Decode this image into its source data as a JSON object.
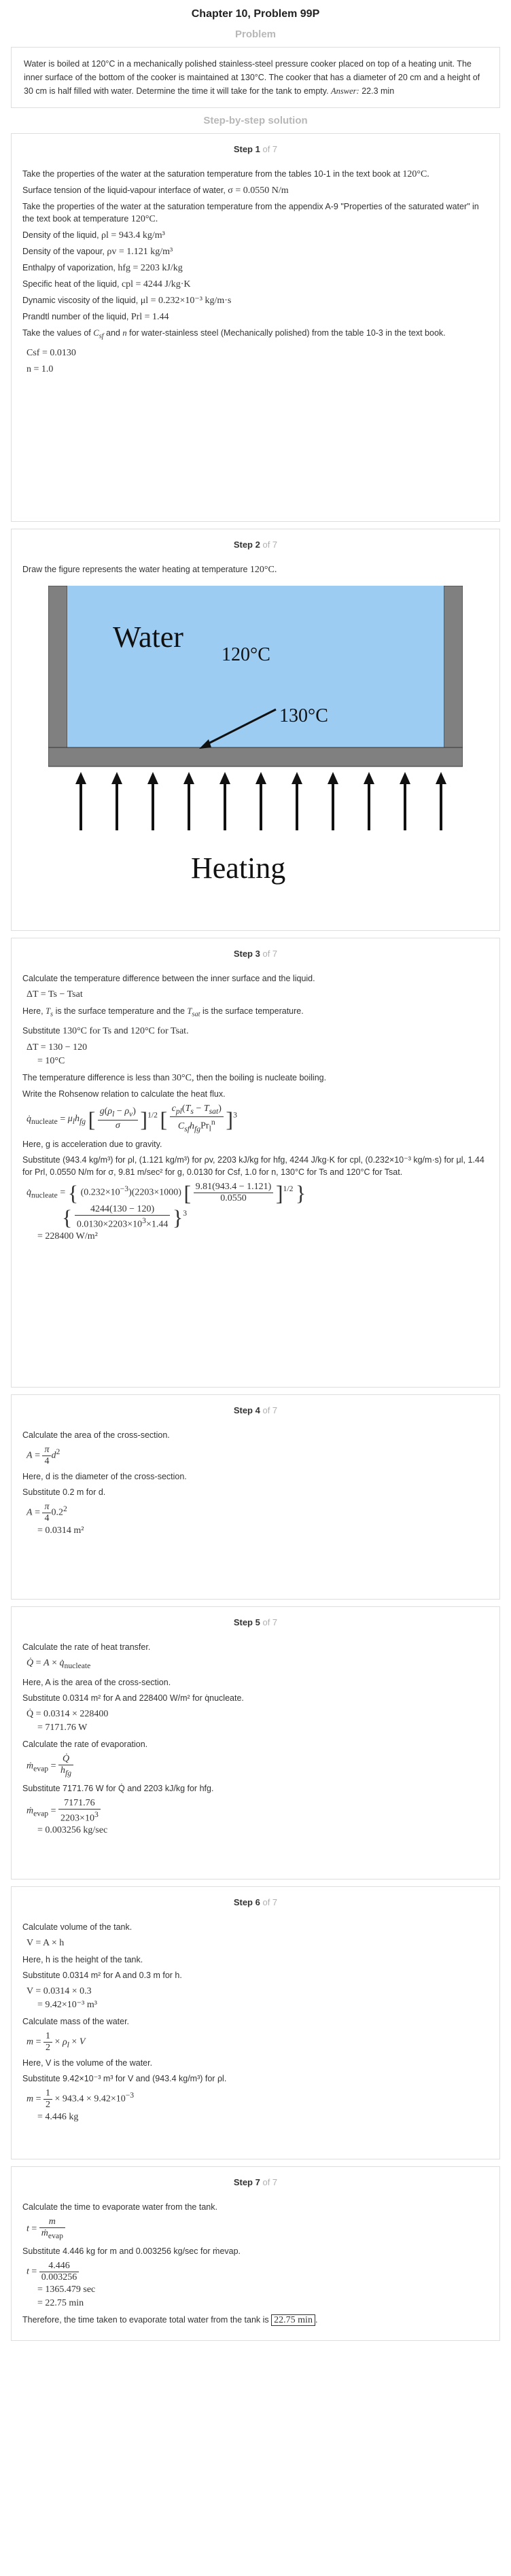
{
  "header": {
    "title": "Chapter 10, Problem 99P",
    "problem_label": "Problem",
    "solution_label": "Step-by-step solution"
  },
  "problem": {
    "text": "Water is boiled at 120°C in a mechanically polished stainless-steel pressure cooker placed on top of a heating unit. The inner surface of the bottom of the cooker is maintained at 130°C. The cooker that has a diameter of 20 cm and a height of 30 cm is half filled with water. Determine the time it will take for the tank to empty.",
    "answer_label": "Answer:",
    "answer_value": "22.3 min"
  },
  "steps": [
    {
      "label": "Step 1",
      "of": "of 7"
    },
    {
      "label": "Step 2",
      "of": "of 7"
    },
    {
      "label": "Step 3",
      "of": "of 7"
    },
    {
      "label": "Step 4",
      "of": "of 7"
    },
    {
      "label": "Step 5",
      "of": "of 7"
    },
    {
      "label": "Step 6",
      "of": "of 7"
    },
    {
      "label": "Step 7",
      "of": "of 7"
    }
  ],
  "step1": {
    "l1": "Take the properties of the water at the saturation temperature from the tables 10-1 in the text book at",
    "l1m": "120°C.",
    "l2": "Surface tension of the liquid-vapour interface of water,",
    "l2m": "σ = 0.0550 N/m",
    "l3": "Take the properties of the water at the saturation temperature from the appendix A-9 \"Properties of the saturated water\" in the text book at temperature",
    "l3m": "120°C.",
    "l4": "Density of the liquid,",
    "l4m": "ρl = 943.4 kg/m³",
    "l5": "Density of the vapour,",
    "l5m": "ρv = 1.121 kg/m³",
    "l6": "Enthalpy of vaporization,",
    "l6m": "hfg = 2203 kJ/kg",
    "l7": "Specific heat of the liquid,",
    "l7m": "cpl = 4244 J/kg·K",
    "l8": "Dynamic viscosity of the liquid,",
    "l8m": "μl = 0.232×10⁻³ kg/m·s",
    "l9": "Prandtl number of the liquid,",
    "l9m": "Prl = 1.44",
    "l10a": "Take the values of",
    "l10b": "and",
    "l10c": "for water-stainless steel (Mechanically polished) from the table 10-3 in the text book.",
    "csf": "Csf = 0.0130",
    "n": "n = 1.0"
  },
  "step2": {
    "text": "Draw the figure represents the water heating at temperature",
    "textm": "120°C.",
    "fig_water": "Water",
    "fig_t1": "120°C",
    "fig_t2": "130°C",
    "fig_heating": "Heating"
  },
  "step3": {
    "l1": "Calculate the temperature difference between the inner surface and the liquid.",
    "eq1": "ΔT = Ts − Tsat",
    "l2a": "Here,",
    "l2b": "is the surface temperature and the",
    "l2c": "is the surface temperature.",
    "sub1a": "Substitute",
    "sub1b": "130°C for Ts",
    "sub1c": "and",
    "sub1d": "120°C for Tsat.",
    "eq2a": "ΔT = 130 − 120",
    "eq2b": "= 10°C",
    "l3": "The temperature difference is less than",
    "l3m": "30°C,",
    "l3b": "then the boiling is nucleate boiling.",
    "l4": "Write the Rohsenow relation to calculate the heat flux.",
    "l5": "Here, g is acceleration due to gravity.",
    "sub2": "Substitute (943.4 kg/m³) for ρl, (1.121 kg/m³) for ρv, 2203 kJ/kg for hfg, 4244 J/kg·K for cpl, (0.232×10⁻³ kg/m·s) for μl, 1.44 for Prl, 0.0550 N/m for σ, 9.81 m/sec² for g, 0.0130 for Csf, 1.0 for n, 130°C for Ts and 120°C for Tsat.",
    "result": "= 228400 W/m²"
  },
  "step4": {
    "l1": "Calculate the area of the cross-section.",
    "l2": "Here, d is the diameter of the cross-section.",
    "l3": "Substitute 0.2 m for d.",
    "res": "= 0.0314 m²"
  },
  "step5": {
    "l1": "Calculate the rate of heat transfer.",
    "l2": "Here, A is the area of the cross-section.",
    "sub1": "Substitute 0.0314 m² for A and 228400 W/m² for q̇nucleate.",
    "eq1": "Q̇ = 0.0314 × 228400",
    "eq1b": "= 7171.76 W",
    "l3": "Calculate the rate of evaporation.",
    "sub2": "Substitute 7171.76 W for Q̇ and 2203 kJ/kg for hfg.",
    "res": "= 0.003256 kg/sec"
  },
  "step6": {
    "l1": "Calculate volume of the tank.",
    "eq1": "V = A × h",
    "l2": "Here, h is the height of the tank.",
    "sub1": "Substitute 0.0314 m² for A and 0.3 m for h.",
    "eq2": "V = 0.0314 × 0.3",
    "eq2b": "= 9.42×10⁻³ m³",
    "l3": "Calculate mass of the water.",
    "l4": "Here, V is the volume of the water.",
    "sub2": "Substitute 9.42×10⁻³ m³ for V and (943.4 kg/m³) for ρl.",
    "res": "= 4.446 kg"
  },
  "step7": {
    "l1": "Calculate the time to evaporate water from the tank.",
    "sub1": "Substitute 4.446 kg for m and 0.003256 kg/sec for ṁevap.",
    "eq2": "= 1365.479 sec",
    "eq3": "= 22.75 min",
    "final": "Therefore, the time taken to evaporate total water from the tank is",
    "final_value": "22.75 min"
  }
}
